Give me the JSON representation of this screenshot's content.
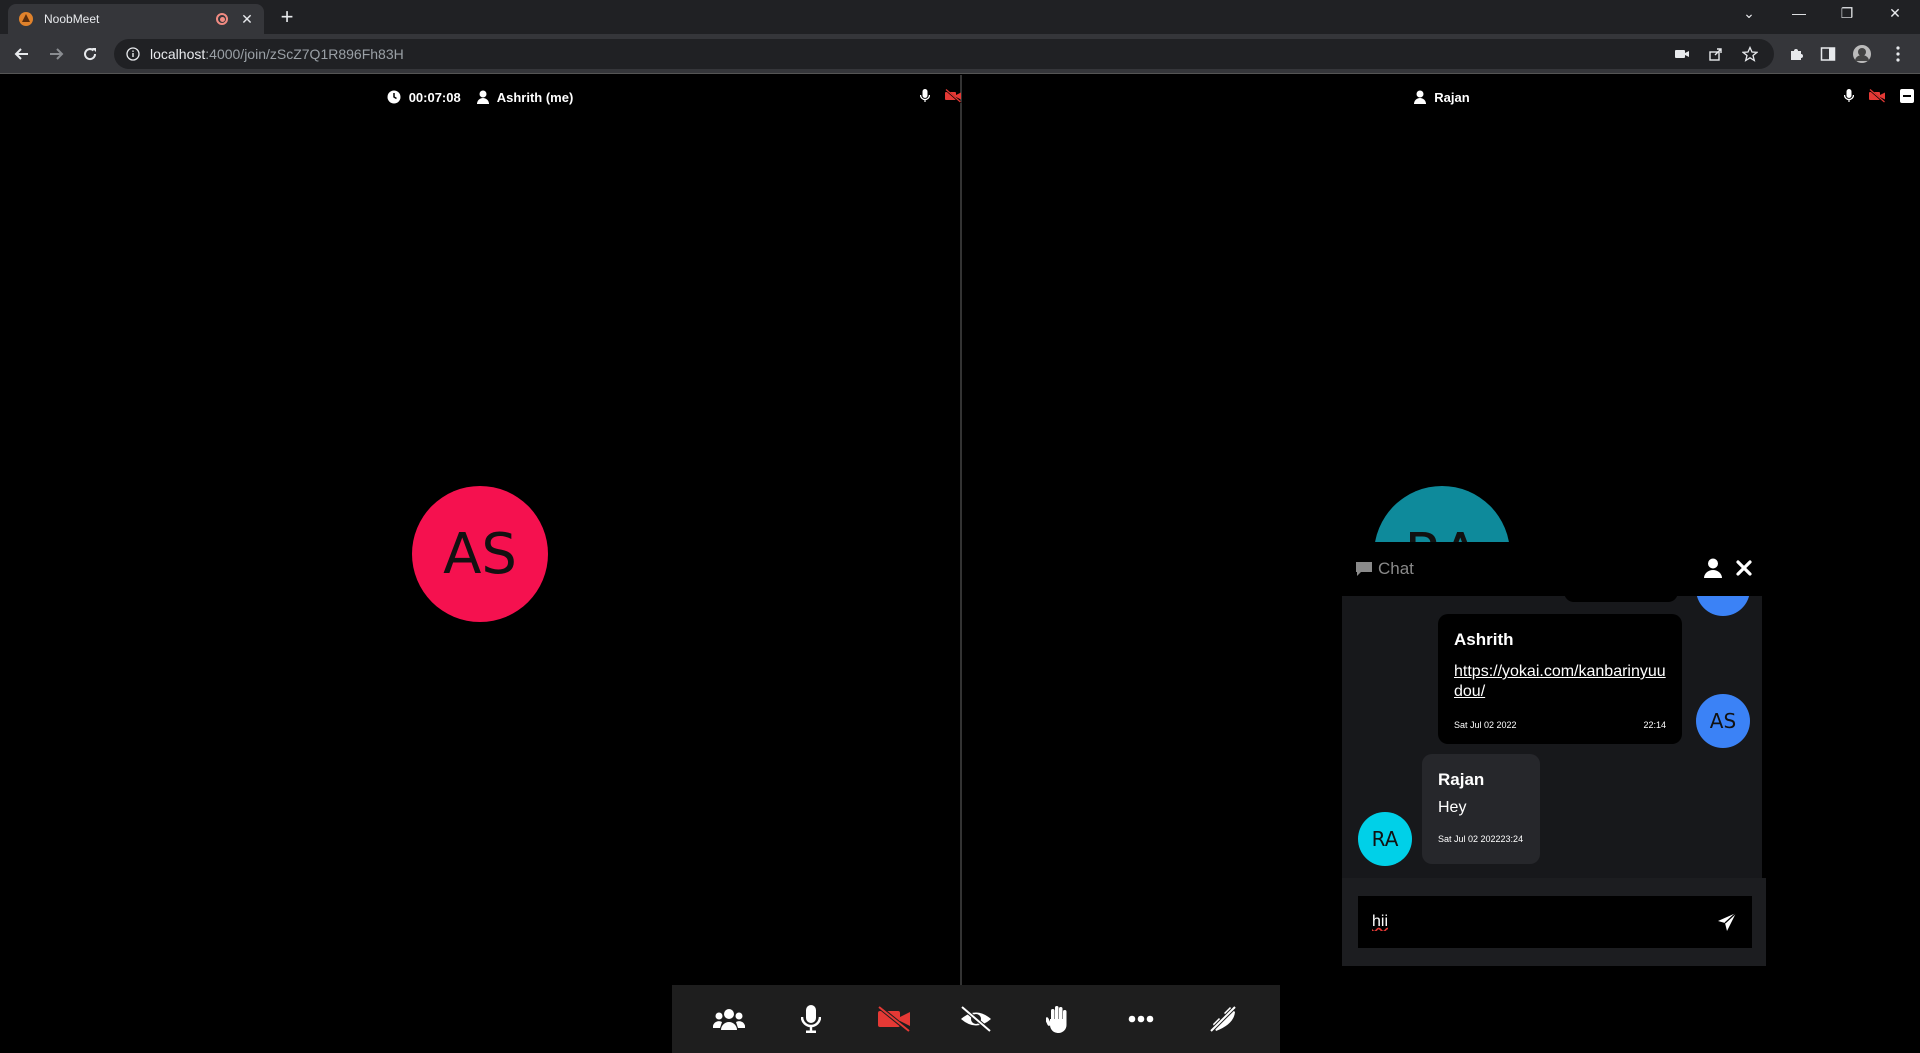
{
  "browser": {
    "tab_title": "NoobMeet",
    "url_host": "localhost",
    "url_path": ":4000/join/zScZ7Q1R896Fh83H"
  },
  "tiles": [
    {
      "timer": "00:07:08",
      "name": "Ashrith (me)",
      "avatar_initials": "AS",
      "avatar_color": "#f5114f"
    },
    {
      "name": "Rajan",
      "avatar_initials": "RA",
      "avatar_color": "#0e8a9b"
    }
  ],
  "toolbar": {
    "buttons": [
      "participants-icon",
      "microphone-icon",
      "camera-off-icon",
      "screen-share-off-icon",
      "raise-hand-icon",
      "more-icon",
      "leave-call-icon"
    ]
  },
  "chat": {
    "title": "Chat",
    "input_value": "hii",
    "messages": [
      {
        "author": "Ashrith",
        "text": "https://yokai.com/kanbarinyuudou/",
        "date": "Sat Jul 02 2022",
        "time": "22:14",
        "avatar": "AS",
        "avatar_color": "#3b82f6"
      },
      {
        "author": "Rajan",
        "text": "Hey",
        "datetime": "Sat Jul 02 202223:24",
        "avatar": "RA",
        "avatar_color": "#00d0e8"
      }
    ]
  },
  "colors": {
    "danger": "#e53935"
  }
}
